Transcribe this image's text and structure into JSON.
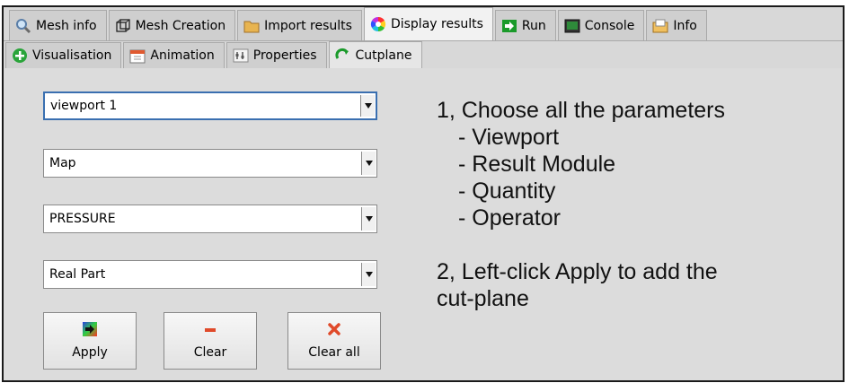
{
  "top_tabs": [
    {
      "label": "Mesh info",
      "icon": "magnifier-icon"
    },
    {
      "label": "Mesh Creation",
      "icon": "cube-icon"
    },
    {
      "label": "Import results",
      "icon": "folder-icon"
    },
    {
      "label": "Display results",
      "icon": "color-wheel-icon"
    },
    {
      "label": "Run",
      "icon": "run-arrow-icon"
    },
    {
      "label": "Console",
      "icon": "console-icon"
    },
    {
      "label": "Info",
      "icon": "info-icon"
    }
  ],
  "sub_tabs": [
    {
      "label": "Visualisation",
      "icon": "plus-circle-icon"
    },
    {
      "label": "Animation",
      "icon": "calendar-icon"
    },
    {
      "label": "Properties",
      "icon": "properties-icon"
    },
    {
      "label": "Cutplane",
      "icon": "cutplane-icon"
    }
  ],
  "selects": {
    "viewport": "viewport 1",
    "module": "Map",
    "quantity": "PRESSURE",
    "operator": "Real Part"
  },
  "buttons": {
    "apply": "Apply",
    "clear": "Clear",
    "clear_all": "Clear all"
  },
  "instructions": {
    "step1": "1, Choose all the parameters",
    "items": [
      "- Viewport",
      "- Result Module",
      "- Quantity",
      "- Operator"
    ],
    "step2_line1": "2, Left-click Apply to add the",
    "step2_line2": "cut-plane"
  },
  "colors": {
    "active_tab": "#f2f2f2",
    "focus_border": "#3a6fb0",
    "run_green": "#1a9a2a",
    "clear_red": "#e04a2a"
  }
}
